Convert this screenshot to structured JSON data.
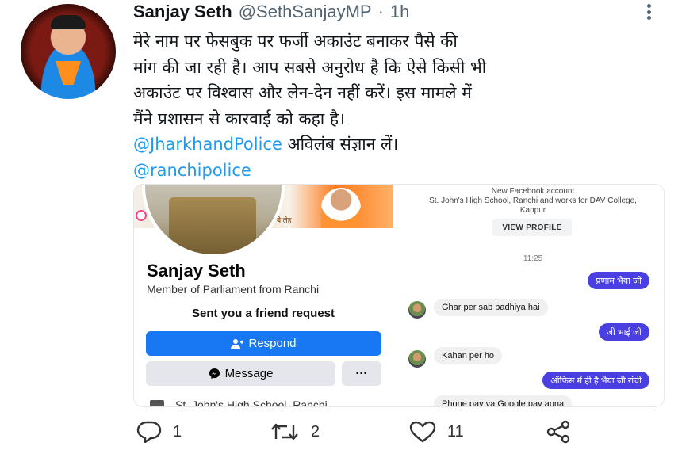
{
  "tweet": {
    "author_name": "Sanjay Seth",
    "author_handle": "@SethSanjayMP",
    "separator": "·",
    "time": "1h",
    "lines": [
      "मेरे नाम पर फेसबुक पर फर्जी अकाउंट बनाकर पैसे की",
      "मांग की जा रही है। आप सबसे अनुरोध है कि ऐसे किसी भी",
      "अकाउंट पर विश्वास और लेन-देन नहीं करें। इस मामले में",
      "मैंने प्रशासन से कारवाई को कहा है।"
    ],
    "mention_police": "@JharkhandPolice",
    "mention_police_suffix": " अविलंब संज्ञान लें।",
    "mention_ranchi": "@ranchipolice"
  },
  "facebook_card": {
    "cover_label": "बे लेह",
    "name": "Sanjay Seth",
    "role": "Member of Parliament from Ranchi",
    "request_text": "Sent you a friend request",
    "respond_label": "Respond",
    "message_label": "Message",
    "more_label": "···",
    "school_partial": "St. John's High School, Ranchi"
  },
  "messenger": {
    "account_label": "New Facebook account",
    "account_info": "St. John's High School, Ranchi and works for DAV College, Kanpur",
    "view_profile": "VIEW PROFILE",
    "time": "11:25",
    "messages": [
      {
        "dir": "out",
        "text": "प्रणाम भैया जी"
      },
      {
        "dir": "in",
        "text": "Ghar per sab badhiya hai"
      },
      {
        "dir": "out",
        "text": "जी भाई जी"
      },
      {
        "dir": "in",
        "text": "Kahan per ho"
      },
      {
        "dir": "out",
        "text": "ऑफिस में ही है भैया जी रांची"
      },
      {
        "dir": "in",
        "text": "Phone pay va Google pay apna"
      }
    ]
  },
  "actions": {
    "reply_count": "1",
    "retweet_count": "2",
    "like_count": "11"
  },
  "icons": {
    "reply": "reply-icon",
    "retweet": "retweet-icon",
    "like": "heart-icon",
    "share": "share-icon",
    "more": "more-icon"
  },
  "colors": {
    "mention": "#1d9bf0",
    "facebook_blue": "#1877f2",
    "messenger_out": "#4a3fe0"
  }
}
